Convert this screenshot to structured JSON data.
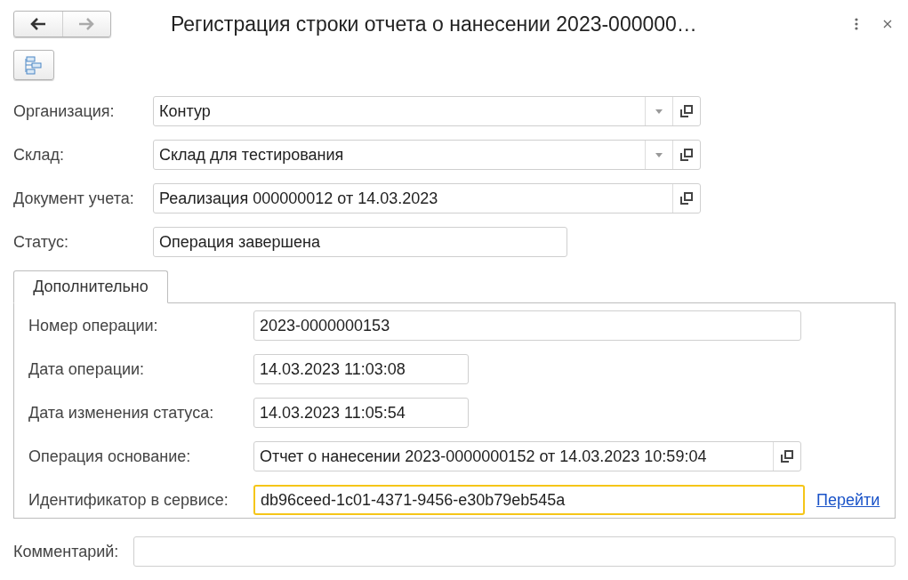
{
  "window": {
    "title": "Регистрация строки отчета о нанесении 2023-000000…"
  },
  "fields": [
    {
      "label": "Организация:",
      "value": "Контур",
      "kind": "select"
    },
    {
      "label": "Склад:",
      "value": "Склад для тестирования",
      "kind": "select"
    },
    {
      "label": "Документ учета:",
      "value": "Реализация 000000012 от 14.03.2023",
      "kind": "reference"
    },
    {
      "label": "Статус:",
      "value": "Операция завершена",
      "kind": "short"
    }
  ],
  "tabs": [
    {
      "label": "Дополнительно",
      "selected": true
    }
  ],
  "tab_fields": [
    {
      "label": "Номер операции:",
      "value": "2023-0000000153",
      "kind": "text",
      "focused": false
    },
    {
      "label": "Дата операции:",
      "value": "14.03.2023 11:03:08",
      "kind": "date",
      "focused": false
    },
    {
      "label": "Дата изменения статуса:",
      "value": "14.03.2023 11:05:54",
      "kind": "date",
      "focused": false
    },
    {
      "label": "Операция основание:",
      "value": "Отчет о нанесении 2023-0000000152 от 14.03.2023 10:59:04",
      "kind": "reference",
      "focused": false
    },
    {
      "label": "Идентификатор в сервисе:",
      "value": "db96ceed-1c01-4371-9456-e30b79eb545a",
      "kind": "link",
      "link": "Перейти",
      "focused": true
    }
  ],
  "comment": {
    "label": "Комментарий:"
  }
}
